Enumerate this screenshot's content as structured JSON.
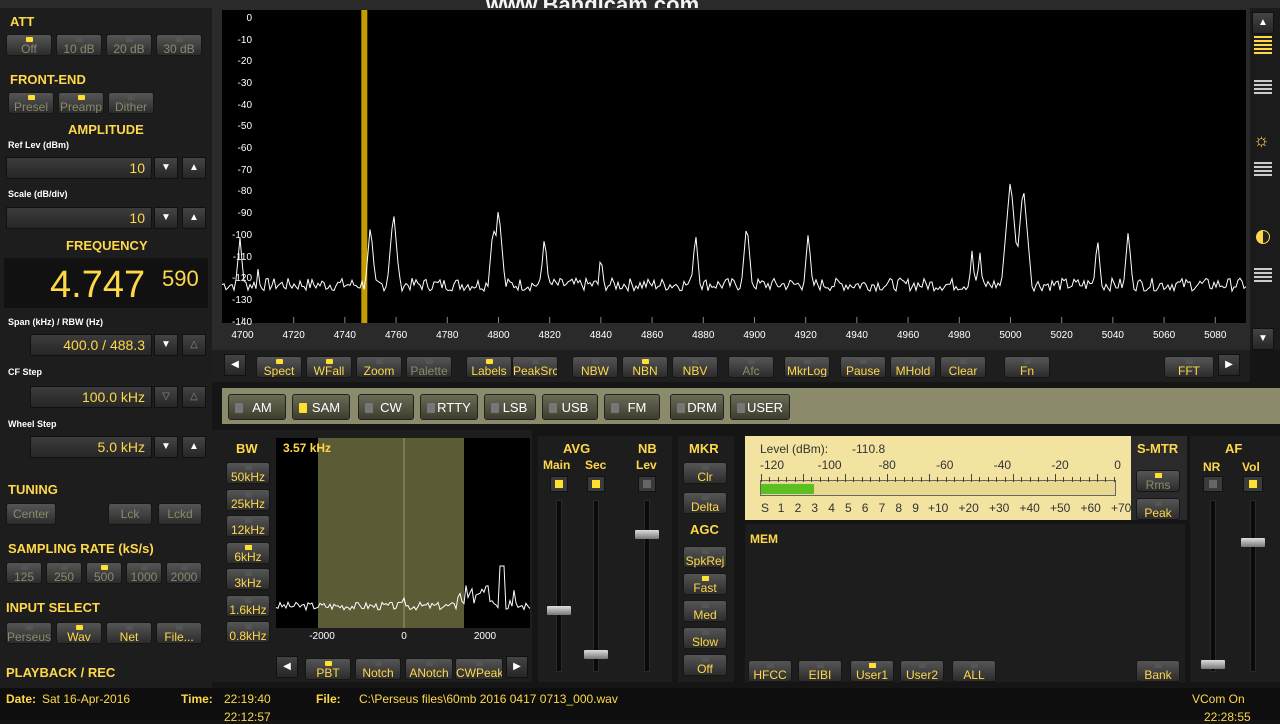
{
  "watermark": "www.Bandicam.com",
  "att": {
    "title": "ATT",
    "buttons": [
      "Off",
      "10 dB",
      "20 dB",
      "30 dB"
    ]
  },
  "frontend": {
    "title": "FRONT-END",
    "buttons": [
      "Presel",
      "Preamp",
      "Dither"
    ]
  },
  "amplitude": {
    "title": "AMPLITUDE",
    "ref_label": "Ref Lev (dBm)",
    "ref_value": "10",
    "scale_label": "Scale (dB/div)",
    "scale_value": "10"
  },
  "frequency": {
    "title": "FREQUENCY",
    "main": "4.747",
    "sub": "590",
    "span_label": "Span (kHz) / RBW (Hz)",
    "span_value": "400.0 / 488.3",
    "cf_label": "CF Step",
    "cf_value": "100.0 kHz",
    "wheel_label": "Wheel Step",
    "wheel_value": "5.0 kHz"
  },
  "tuning": {
    "title": "TUNING",
    "buttons": [
      "Center",
      "Lck",
      "Lckd"
    ]
  },
  "sampling": {
    "title": "SAMPLING RATE (kS/s)",
    "buttons": [
      "125",
      "250",
      "500",
      "1000",
      "2000"
    ]
  },
  "input": {
    "title": "INPUT SELECT",
    "buttons": [
      "Perseus",
      "Wav",
      "Net",
      "File..."
    ]
  },
  "playback_title": "PLAYBACK / REC",
  "status": {
    "date_label": "Date:",
    "date": "Sat 16-Apr-2016",
    "time_label": "Time:",
    "time": "22:19:40",
    "time2": "22:12:57",
    "file_label": "File:",
    "file": "C:\\Perseus files\\60mb 2016 0417 0713_000.wav",
    "vcom": "VCom On",
    "clock2": "22:28:55"
  },
  "spectrum": {
    "y_ticks": [
      "0",
      "-10",
      "-20",
      "-30",
      "-40",
      "-50",
      "-60",
      "-70",
      "-80",
      "-90",
      "-100",
      "-110",
      "-120",
      "-130",
      "-140"
    ],
    "x_ticks": [
      "4700",
      "4720",
      "4740",
      "4760",
      "4780",
      "4800",
      "4820",
      "4840",
      "4860",
      "4880",
      "4900",
      "4920",
      "4940",
      "4960",
      "4980",
      "5000",
      "5020",
      "5040",
      "5060",
      "5080"
    ],
    "marker_khz": 4747.59,
    "x_range_khz": [
      4692,
      5092
    ],
    "y_range_dbm": [
      0,
      -140
    ]
  },
  "spectrum_buttons": [
    "Spect",
    "WFall",
    "Zoom",
    "Palette",
    "Labels",
    "PeakSrc",
    "NBW",
    "NBN",
    "NBV",
    "Afc",
    "MkrLog",
    "Pause",
    "MHold",
    "Clear",
    "Fn",
    "FFT"
  ],
  "modes": [
    "AM",
    "SAM",
    "CW",
    "RTTY",
    "LSB",
    "USB",
    "FM",
    "DRM",
    "USER"
  ],
  "bw": {
    "title": "BW",
    "value": "3.57 kHz",
    "buttons": [
      "50kHz",
      "25kHz",
      "12kHz",
      "6kHz",
      "3kHz",
      "1.6kHz",
      "0.8kHz"
    ],
    "x_ticks": [
      "-2000",
      "0",
      "2000"
    ],
    "bottom_buttons": [
      "PBT",
      "Notch",
      "ANotch",
      "CWPeak"
    ]
  },
  "avg": {
    "title": "AVG",
    "main": "Main",
    "sec": "Sec"
  },
  "nb": {
    "title": "NB",
    "lev": "Lev"
  },
  "mkr": {
    "title": "MKR",
    "buttons": [
      "Clr",
      "Delta"
    ]
  },
  "agc": {
    "title": "AGC",
    "buttons": [
      "SpkRej",
      "Fast",
      "Med",
      "Slow",
      "Off"
    ]
  },
  "level": {
    "label": "Level (dBm):",
    "value": "-110.8",
    "dbm_scale": [
      "-120",
      "-100",
      "-80",
      "-60",
      "-40",
      "-20",
      "0"
    ],
    "s_scale": [
      "S",
      "1",
      "2",
      "3",
      "4",
      "5",
      "6",
      "7",
      "8",
      "9",
      "+10",
      "+20",
      "+30",
      "+40",
      "+50",
      "+60",
      "+70"
    ],
    "bar_fraction": 0.15
  },
  "smtr": {
    "title": "S-MTR",
    "buttons": [
      "Rms",
      "Peak"
    ]
  },
  "af": {
    "title": "AF",
    "nr": "NR",
    "vol": "Vol"
  },
  "mem": {
    "title": "MEM",
    "buttons": [
      "HFCC",
      "EIBI",
      "User1",
      "User2",
      "ALL"
    ],
    "bank": "Bank"
  }
}
